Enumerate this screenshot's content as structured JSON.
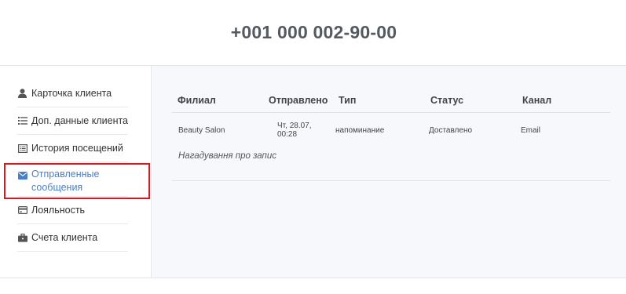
{
  "header": {
    "phone": "+001 000 002-90-00"
  },
  "sidebar": {
    "items": [
      {
        "label": "Карточка клиента",
        "icon": "person-icon"
      },
      {
        "label": "Доп. данные клиента",
        "icon": "list-icon"
      },
      {
        "label": "История посещений",
        "icon": "history-list-icon"
      },
      {
        "label": "Отправленные сообщения",
        "icon": "envelope-icon",
        "active": true
      },
      {
        "label": "Лояльность",
        "icon": "credit-card-icon"
      },
      {
        "label": "Счета клиента",
        "icon": "briefcase-icon"
      }
    ]
  },
  "table": {
    "columns": [
      "Филиал",
      "Отправлено",
      "Тип",
      "Статус",
      "Канал"
    ],
    "rows": [
      {
        "branch": "Beauty Salon",
        "sent": "Чт, 28.07, 00:28",
        "type": "напоминание",
        "status": "Доставлено",
        "channel": "Email",
        "message": "Нагадування про запис"
      }
    ]
  },
  "colors": {
    "active": "#4b7fc4",
    "highlight": "#e0141a",
    "content_bg": "#f7f8fc"
  }
}
